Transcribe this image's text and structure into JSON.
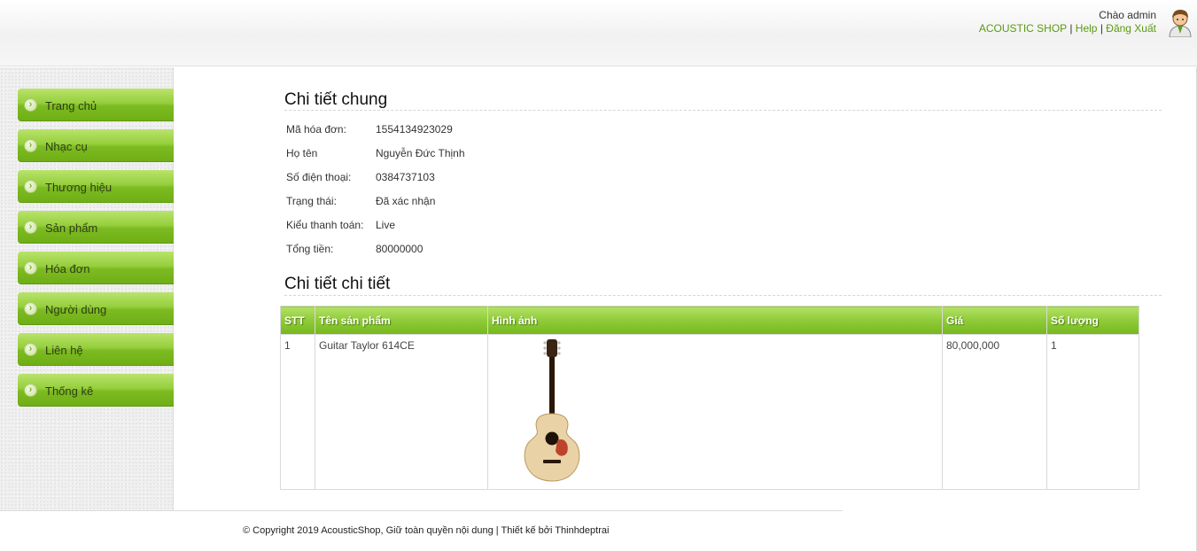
{
  "header": {
    "greeting": "Chào admin",
    "links": [
      {
        "label": "ACOUSTIC SHOP"
      },
      {
        "label": "Help"
      },
      {
        "label": "Đăng Xuất"
      }
    ],
    "separator": "|",
    "avatar_icon": "user-avatar-icon"
  },
  "sidebar": {
    "items": [
      {
        "label": "Trang chủ"
      },
      {
        "label": "Nhạc cụ"
      },
      {
        "label": "Thương hiệu"
      },
      {
        "label": "Sản phẩm"
      },
      {
        "label": "Hóa đơn"
      },
      {
        "label": "Người dùng"
      },
      {
        "label": "Liên hệ"
      },
      {
        "label": "Thống kê"
      }
    ],
    "bullet_icon": "chevron-right-circle-icon",
    "accent_color": "#7cbb21"
  },
  "general": {
    "title": "Chi tiết chung",
    "fields": [
      {
        "label": "Mã hóa đơn:",
        "value": "1554134923029"
      },
      {
        "label": "Họ tên",
        "value": "Nguyễn Đức Thịnh"
      },
      {
        "label": "Số điện thoại:",
        "value": "0384737103"
      },
      {
        "label": "Trạng thái:",
        "value": "Đã xác nhận"
      },
      {
        "label": "Kiểu thanh toán:",
        "value": "Live"
      },
      {
        "label": "Tổng tiền:",
        "value": "80000000"
      }
    ]
  },
  "detail": {
    "title": "Chi tiết chi tiết",
    "columns": [
      "STT",
      "Tên sản phẩm",
      "Hình ảnh",
      "Giá",
      "Số lượng"
    ],
    "rows": [
      {
        "stt": "1",
        "name": "Guitar Taylor 614CE",
        "image_icon": "acoustic-guitar-image",
        "price": "80,000,000",
        "qty": "1"
      }
    ]
  },
  "footer": {
    "text": "© Copyright 2019 AcousticShop, Giữ toàn quyền nội dung | Thiết kế bởi Thinhdeptrai"
  }
}
